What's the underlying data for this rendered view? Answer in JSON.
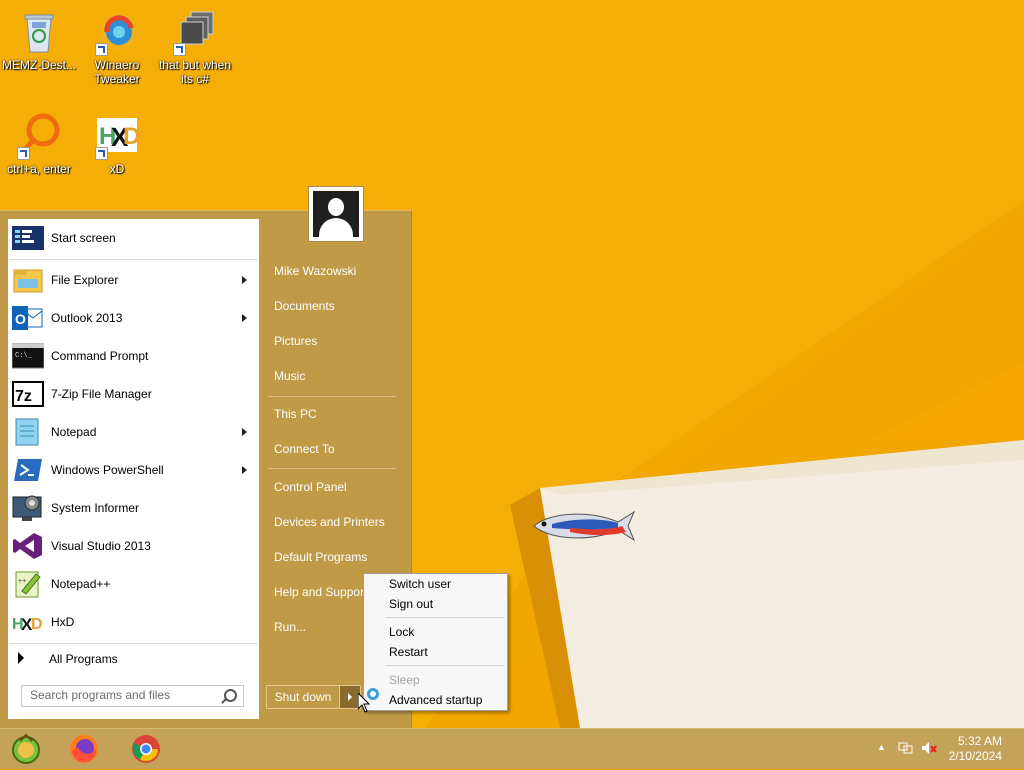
{
  "desktop": {
    "icons": [
      {
        "label": "MEMZ-Dest...",
        "icon": "recycle-bin-icon"
      },
      {
        "label": "Winaero Tweaker",
        "icon": "winaero-tweaker-icon"
      },
      {
        "label": "that but when its c#",
        "icon": "shortcut-stack-icon"
      },
      {
        "label": "ctrl+a, enter",
        "icon": "magnifier-ring-icon"
      },
      {
        "label": "xD",
        "icon": "hxd-icon"
      }
    ]
  },
  "start_menu": {
    "programs": [
      {
        "label": "Start screen",
        "icon": "start-screen-icon",
        "has_submenu": false
      },
      {
        "label": "File Explorer",
        "icon": "file-explorer-icon",
        "has_submenu": true
      },
      {
        "label": "Outlook 2013",
        "icon": "outlook-icon",
        "has_submenu": true
      },
      {
        "label": "Command Prompt",
        "icon": "command-prompt-icon",
        "has_submenu": false
      },
      {
        "label": "7-Zip File Manager",
        "icon": "7zip-icon",
        "has_submenu": false
      },
      {
        "label": "Notepad",
        "icon": "notepad-icon",
        "has_submenu": true
      },
      {
        "label": "Windows PowerShell",
        "icon": "powershell-icon",
        "has_submenu": true
      },
      {
        "label": "System Informer",
        "icon": "system-informer-icon",
        "has_submenu": false
      },
      {
        "label": "Visual Studio 2013",
        "icon": "visual-studio-icon",
        "has_submenu": false
      },
      {
        "label": "Notepad++",
        "icon": "notepadpp-icon",
        "has_submenu": false
      },
      {
        "label": "HxD",
        "icon": "hxd-icon",
        "has_submenu": false
      }
    ],
    "all_programs": "All Programs",
    "search_placeholder": "Search programs and files",
    "right_items": {
      "user": "Mike Wazowski",
      "documents": "Documents",
      "pictures": "Pictures",
      "music": "Music",
      "this_pc": "This PC",
      "connect_to": "Connect To",
      "control_panel": "Control Panel",
      "devices_printers": "Devices and Printers",
      "default_programs": "Default Programs",
      "help_support": "Help and Suppor",
      "run": "Run..."
    },
    "shutdown_label": "Shut down"
  },
  "power_menu": {
    "switch_user": "Switch user",
    "sign_out": "Sign out",
    "lock": "Lock",
    "restart": "Restart",
    "sleep": "Sleep",
    "advanced_startup": "Advanced startup"
  },
  "taskbar": {
    "pinned": [
      "start-orb-icon",
      "firefox-icon",
      "chrome-icon"
    ],
    "time": "5:32 AM",
    "date": "2/10/2024"
  },
  "colors": {
    "wallpaper": "#f3a800",
    "start_menu_bg": "#c19a48",
    "taskbar_bg": "#c4a259"
  }
}
